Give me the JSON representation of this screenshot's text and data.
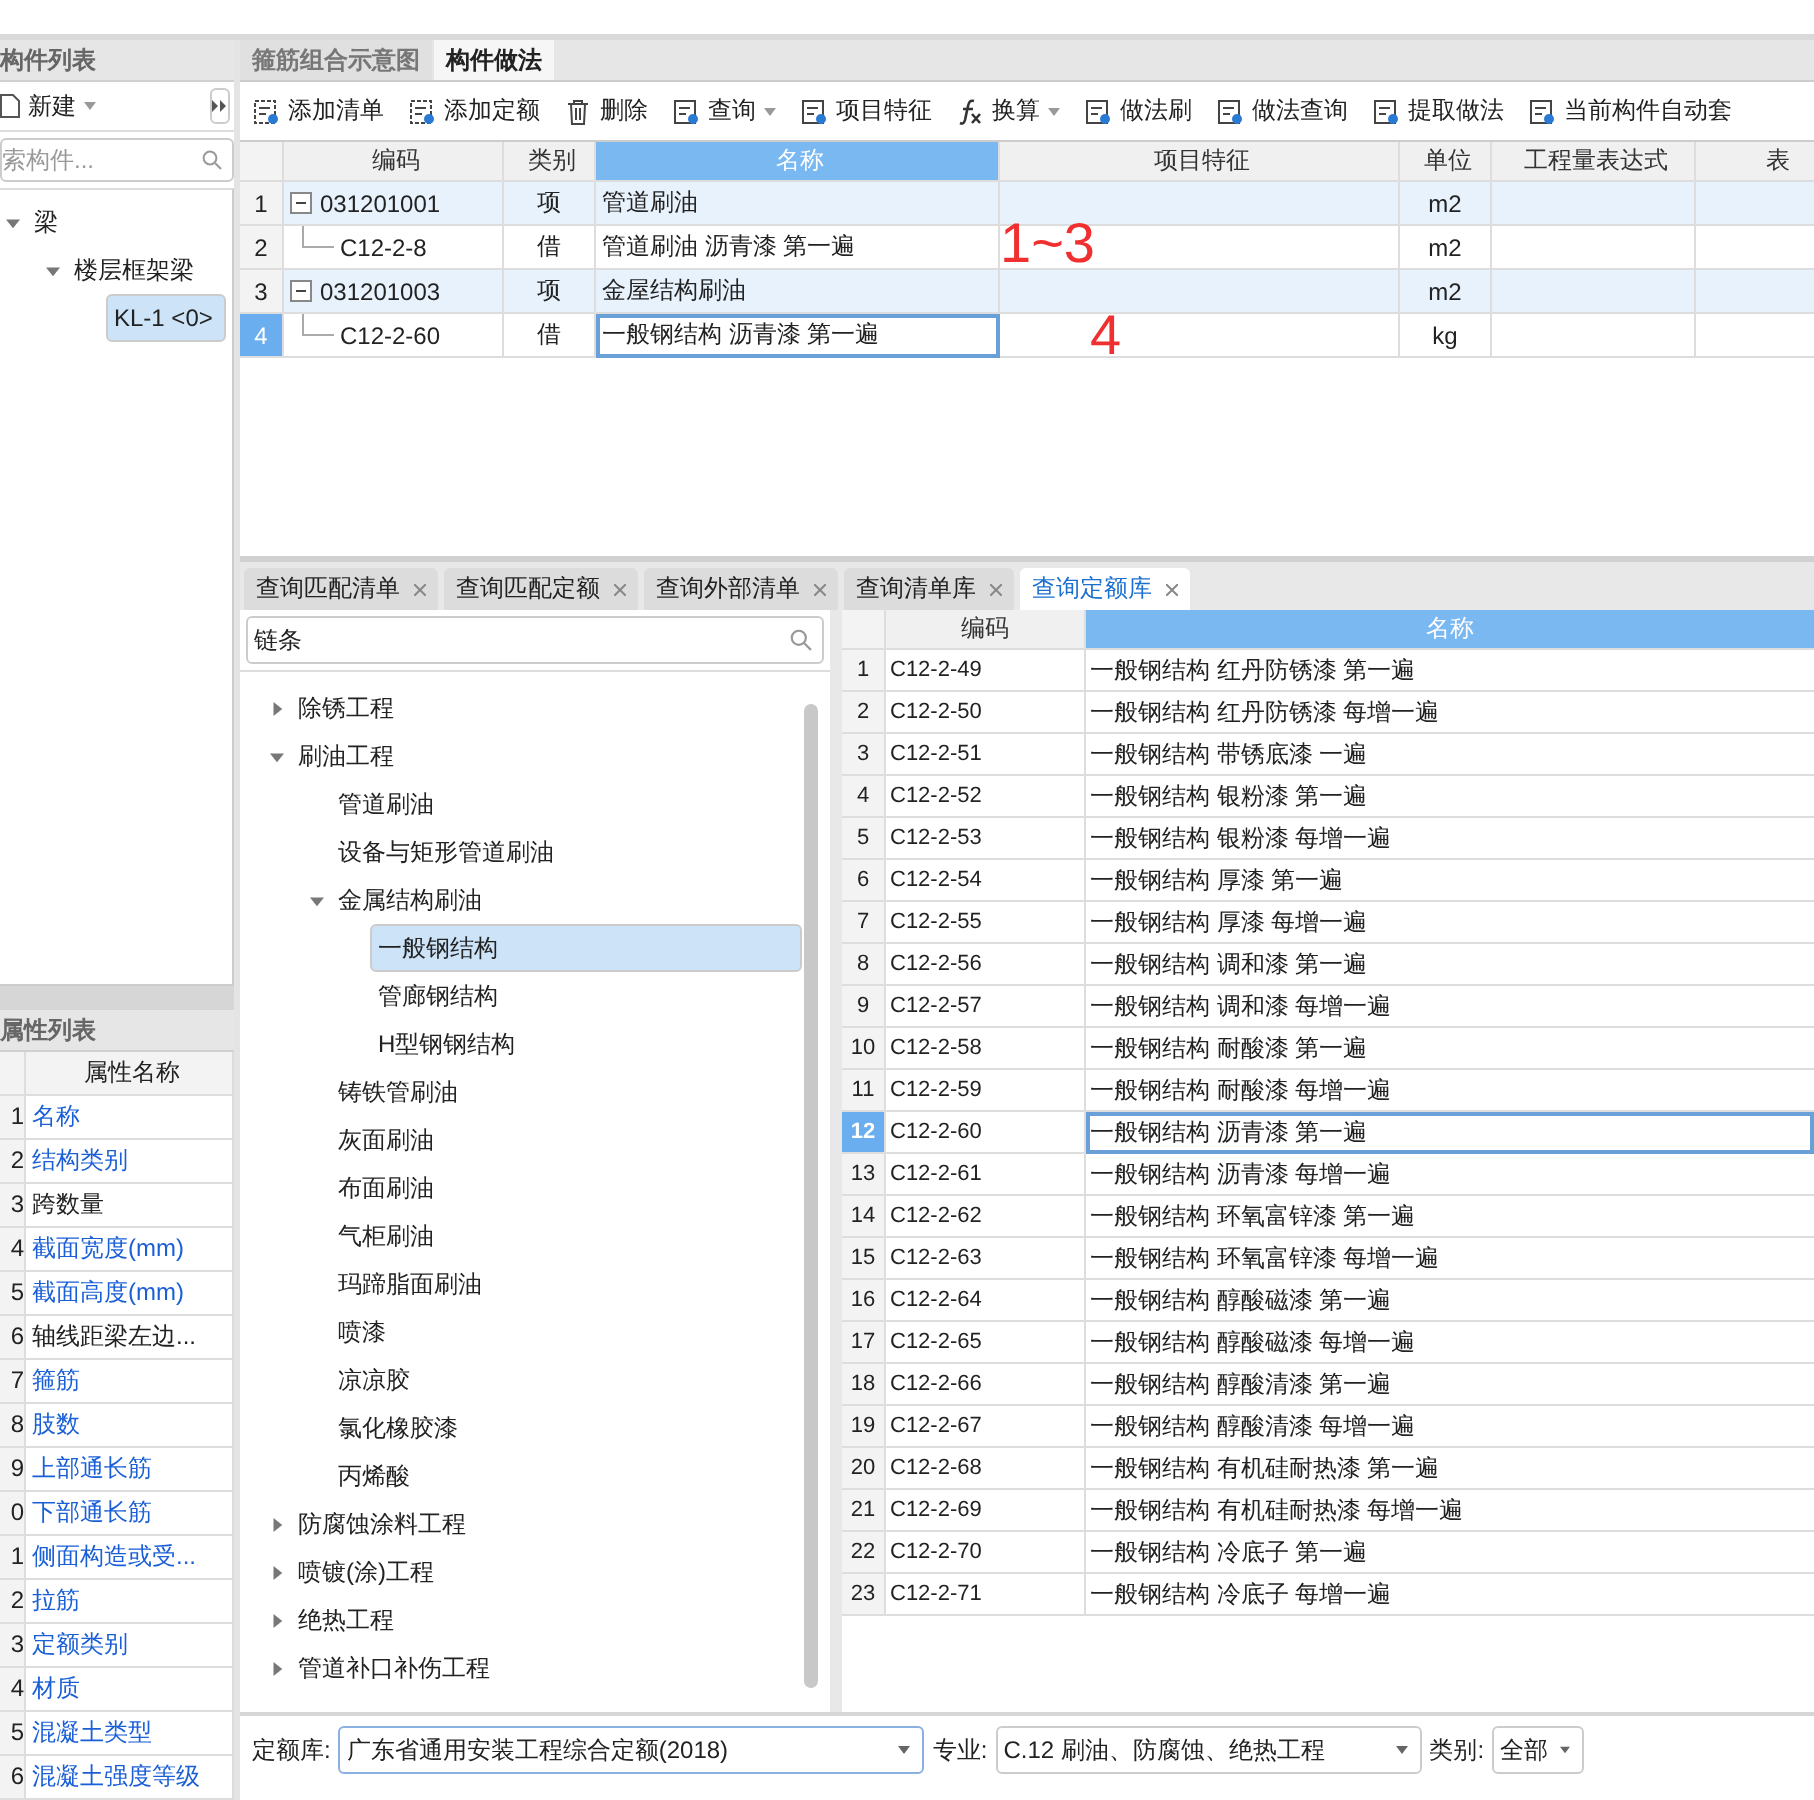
{
  "component_panel": {
    "title": "构件列表",
    "new_button": "新建",
    "search_placeholder": "索构件...",
    "tree": [
      {
        "label": "梁",
        "expanded": true,
        "selected": false,
        "children": [
          {
            "label": "楼层框架梁",
            "expanded": true,
            "selected": false,
            "children": [
              {
                "label": "KL-1 <0>",
                "selected": true
              }
            ]
          }
        ]
      }
    ]
  },
  "property_panel": {
    "title": "属性列表",
    "header": "属性名称",
    "rows": [
      {
        "num": "1",
        "name": "名称",
        "color": "#1a5fd6"
      },
      {
        "num": "2",
        "name": "结构类别",
        "color": "#1a5fd6"
      },
      {
        "num": "3",
        "name": "跨数量",
        "color": "#222222"
      },
      {
        "num": "4",
        "name": "截面宽度(mm)",
        "color": "#1a5fd6"
      },
      {
        "num": "5",
        "name": "截面高度(mm)",
        "color": "#1a5fd6"
      },
      {
        "num": "6",
        "name": "轴线距梁左边...",
        "color": "#222222"
      },
      {
        "num": "7",
        "name": "箍筋",
        "color": "#1a5fd6"
      },
      {
        "num": "8",
        "name": "肢数",
        "color": "#1a5fd6"
      },
      {
        "num": "9",
        "name": "上部通长筋",
        "color": "#1a5fd6"
      },
      {
        "num": "0",
        "name": "下部通长筋",
        "color": "#1a5fd6"
      },
      {
        "num": "1",
        "name": "侧面构造或受...",
        "color": "#1a5fd6"
      },
      {
        "num": "2",
        "name": "拉筋",
        "color": "#1a5fd6"
      },
      {
        "num": "3",
        "name": "定额类别",
        "color": "#1a5fd6"
      },
      {
        "num": "4",
        "name": "材质",
        "color": "#1a5fd6"
      },
      {
        "num": "5",
        "name": "混凝土类型",
        "color": "#1a5fd6"
      },
      {
        "num": "6",
        "name": "混凝土强度等级",
        "color": "#1a5fd6"
      }
    ]
  },
  "tabs": [
    {
      "label": "箍筋组合示意图",
      "selected": false
    },
    {
      "label": "构件做法",
      "selected": true
    }
  ],
  "toolbar": [
    {
      "label": "添加清单",
      "dropdown": false
    },
    {
      "label": "添加定额",
      "dropdown": false
    },
    {
      "label": "删除",
      "dropdown": false
    },
    {
      "label": "查询",
      "dropdown": true
    },
    {
      "label": "项目特征",
      "dropdown": false
    },
    {
      "label": "换算",
      "dropdown": true
    },
    {
      "label": "做法刷",
      "dropdown": false
    },
    {
      "label": "做法查询",
      "dropdown": false
    },
    {
      "label": "提取做法",
      "dropdown": false
    },
    {
      "label": "当前构件自动套",
      "dropdown": false
    }
  ],
  "table": {
    "columns": [
      {
        "label": "编码",
        "selected": false
      },
      {
        "label": "类别",
        "selected": false
      },
      {
        "label": "名称",
        "selected": true
      },
      {
        "label": "项目特征",
        "selected": false
      },
      {
        "label": "单位",
        "selected": false
      },
      {
        "label": "工程量表达式",
        "selected": false
      },
      {
        "label": "表",
        "selected": false
      }
    ],
    "rows": [
      {
        "num": "1",
        "kind": "list",
        "code": "031201001",
        "type": "项",
        "name": "管道刷油",
        "unit": "m2",
        "selected": false
      },
      {
        "num": "2",
        "kind": "quota",
        "code": "C12-2-8",
        "type": "借",
        "name": "管道刷油 沥青漆 第一遍",
        "unit": "m2",
        "selected": false
      },
      {
        "num": "3",
        "kind": "list",
        "code": "031201003",
        "type": "项",
        "name": "金屋结构刷油",
        "unit": "m2",
        "selected": false
      },
      {
        "num": "4",
        "kind": "quota",
        "code": "C12-2-60",
        "type": "借",
        "name": "一般钢结构 沥青漆 第一遍",
        "unit": "kg",
        "selected": true
      }
    ]
  },
  "annotations": [
    {
      "text": "1~3"
    },
    {
      "text": "4"
    }
  ],
  "query_tabs": [
    {
      "label": "查询匹配清单",
      "selected": false
    },
    {
      "label": "查询匹配定额",
      "selected": false
    },
    {
      "label": "查询外部清单",
      "selected": false
    },
    {
      "label": "查询清单库",
      "selected": false
    },
    {
      "label": "查询定额库",
      "selected": true
    }
  ],
  "quota_search": {
    "value": "链条"
  },
  "quota_tree": [
    {
      "label": "除锈工程",
      "expanded": false,
      "selected": false
    },
    {
      "label": "刷油工程",
      "expanded": true,
      "selected": false,
      "children": [
        {
          "label": "管道刷油",
          "selected": false
        },
        {
          "label": "设备与矩形管道刷油",
          "selected": false
        },
        {
          "label": "金属结构刷油",
          "expanded": true,
          "selected": false,
          "children": [
            {
              "label": "一般钢结构",
              "selected": true
            },
            {
              "label": "管廊钢结构",
              "selected": false
            },
            {
              "label": "H型钢钢结构",
              "selected": false
            }
          ]
        },
        {
          "label": "铸铁管刷油",
          "selected": false
        },
        {
          "label": "灰面刷油",
          "selected": false
        },
        {
          "label": "布面刷油",
          "selected": false
        },
        {
          "label": "气柜刷油",
          "selected": false
        },
        {
          "label": "玛蹄脂面刷油",
          "selected": false
        },
        {
          "label": "喷漆",
          "selected": false
        },
        {
          "label": "凉凉胶",
          "selected": false
        },
        {
          "label": "氯化橡胶漆",
          "selected": false
        },
        {
          "label": "丙烯酸",
          "selected": false
        }
      ]
    },
    {
      "label": "防腐蚀涂料工程",
      "expanded": false,
      "selected": false
    },
    {
      "label": "喷镀(涂)工程",
      "expanded": false,
      "selected": false
    },
    {
      "label": "绝热工程",
      "expanded": false,
      "selected": false
    },
    {
      "label": "管道补口补伤工程",
      "expanded": false,
      "selected": false
    }
  ],
  "quota_table": {
    "columns": [
      {
        "label": "编码",
        "selected": false
      },
      {
        "label": "名称",
        "selected": true
      }
    ],
    "rows": [
      {
        "num": "1",
        "code": "C12-2-49",
        "name": "一般钢结构 红丹防锈漆 第一遍",
        "selected": false
      },
      {
        "num": "2",
        "code": "C12-2-50",
        "name": "一般钢结构 红丹防锈漆 每增一遍",
        "selected": false
      },
      {
        "num": "3",
        "code": "C12-2-51",
        "name": "一般钢结构 带锈底漆 一遍",
        "selected": false
      },
      {
        "num": "4",
        "code": "C12-2-52",
        "name": "一般钢结构 银粉漆 第一遍",
        "selected": false
      },
      {
        "num": "5",
        "code": "C12-2-53",
        "name": "一般钢结构 银粉漆 每增一遍",
        "selected": false
      },
      {
        "num": "6",
        "code": "C12-2-54",
        "name": "一般钢结构 厚漆 第一遍",
        "selected": false
      },
      {
        "num": "7",
        "code": "C12-2-55",
        "name": "一般钢结构 厚漆 每增一遍",
        "selected": false
      },
      {
        "num": "8",
        "code": "C12-2-56",
        "name": "一般钢结构 调和漆 第一遍",
        "selected": false
      },
      {
        "num": "9",
        "code": "C12-2-57",
        "name": "一般钢结构 调和漆 每增一遍",
        "selected": false
      },
      {
        "num": "10",
        "code": "C12-2-58",
        "name": "一般钢结构 耐酸漆 第一遍",
        "selected": false
      },
      {
        "num": "11",
        "code": "C12-2-59",
        "name": "一般钢结构 耐酸漆 每增一遍",
        "selected": false
      },
      {
        "num": "12",
        "code": "C12-2-60",
        "name": "一般钢结构 沥青漆 第一遍",
        "selected": true
      },
      {
        "num": "13",
        "code": "C12-2-61",
        "name": "一般钢结构 沥青漆 每增一遍",
        "selected": false
      },
      {
        "num": "14",
        "code": "C12-2-62",
        "name": "一般钢结构 环氧富锌漆 第一遍",
        "selected": false
      },
      {
        "num": "15",
        "code": "C12-2-63",
        "name": "一般钢结构 环氧富锌漆 每增一遍",
        "selected": false
      },
      {
        "num": "16",
        "code": "C12-2-64",
        "name": "一般钢结构 醇酸磁漆 第一遍",
        "selected": false
      },
      {
        "num": "17",
        "code": "C12-2-65",
        "name": "一般钢结构 醇酸磁漆 每增一遍",
        "selected": false
      },
      {
        "num": "18",
        "code": "C12-2-66",
        "name": "一般钢结构 醇酸清漆 第一遍",
        "selected": false
      },
      {
        "num": "19",
        "code": "C12-2-67",
        "name": "一般钢结构 醇酸清漆 每增一遍",
        "selected": false
      },
      {
        "num": "20",
        "code": "C12-2-68",
        "name": "一般钢结构 有机硅耐热漆 第一遍",
        "selected": false
      },
      {
        "num": "21",
        "code": "C12-2-69",
        "name": "一般钢结构 有机硅耐热漆 每增一遍",
        "selected": false
      },
      {
        "num": "22",
        "code": "C12-2-70",
        "name": "一般钢结构 冷底子 第一遍",
        "selected": false
      },
      {
        "num": "23",
        "code": "C12-2-71",
        "name": "一般钢结构 冷底子 每增一遍",
        "selected": false
      }
    ]
  },
  "filter_bar": {
    "library_label": "定额库:",
    "library": "广东省通用安装工程综合定额(2018)",
    "specialty_label": "专业:",
    "specialty": "C.12 刷油、防腐蚀、绝热工程",
    "category_label": "类别:",
    "category": "全部"
  }
}
